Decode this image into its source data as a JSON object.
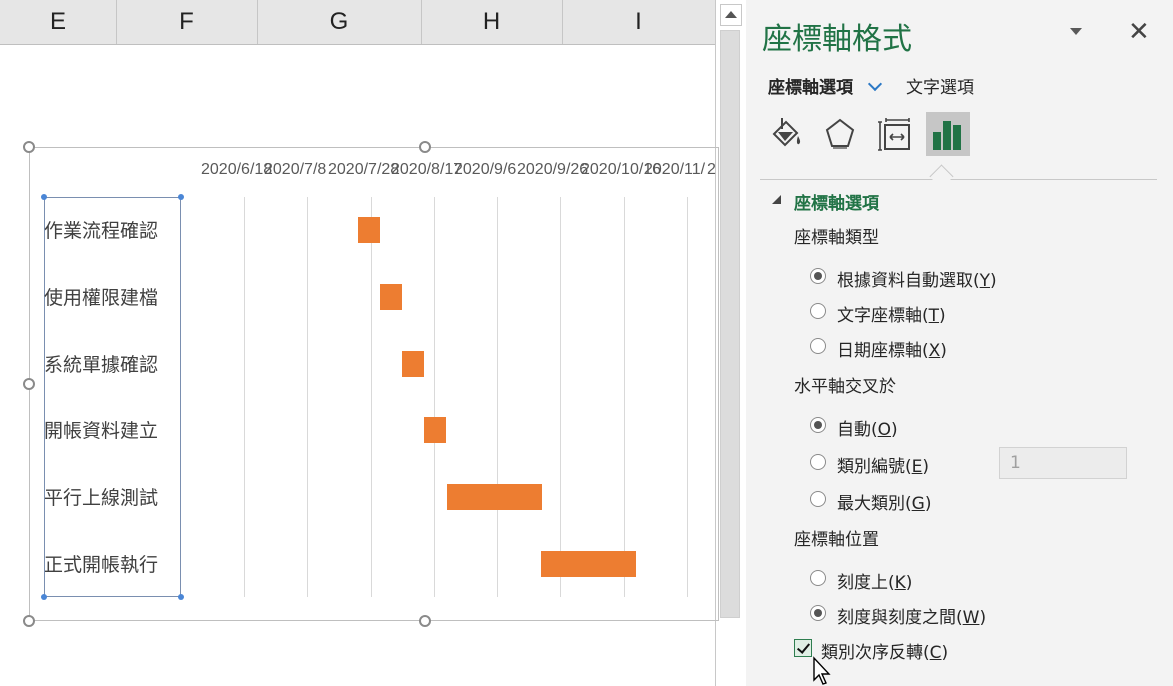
{
  "sheet": {
    "columns": [
      "E",
      "F",
      "G",
      "H",
      "I"
    ]
  },
  "chart": {
    "x_tick_labels": [
      "2020/6/18",
      "2020/7/8",
      "2020/7/28",
      "2020/8/17",
      "2020/9/6",
      "2020/9/26",
      "2020/10/16",
      "2020/11/",
      "2"
    ],
    "categories": [
      "作業流程確認",
      "使用權限建檔",
      "系統單據確認",
      "開帳資料建立",
      "平行上線測試",
      "正式開帳執行"
    ],
    "bar_color": "#ed7d31"
  },
  "chart_data": {
    "type": "bar",
    "orientation": "horizontal",
    "stacked": true,
    "categories": [
      "作業流程確認",
      "使用權限建檔",
      "系統單據確認",
      "開帳資料建立",
      "平行上線測試",
      "正式開帳執行"
    ],
    "x_tick_labels": [
      "2020/6/18",
      "2020/7/8",
      "2020/7/28",
      "2020/8/17",
      "2020/9/6",
      "2020/9/26",
      "2020/10/16",
      "2020/11/"
    ],
    "series": [
      {
        "values": [
          "2020/7/24",
          "2020/7/31",
          "2020/8/7",
          "2020/8/14",
          "2020/8/21",
          "2020/9/20"
        ]
      },
      {
        "values": [
          7,
          7,
          7,
          7,
          30,
          30
        ],
        "color": "#ed7d31"
      }
    ],
    "xlim": [
      "2020/5/29",
      "2020/11/25"
    ],
    "category_order": "reversed",
    "grid": true
  },
  "pane": {
    "title": "座標軸格式",
    "close_label": "✕",
    "tabs": [
      "座標軸選項",
      "文字選項"
    ],
    "icons": [
      "fill-line-icon",
      "effects-icon",
      "size-properties-icon",
      "axis-options-icon"
    ],
    "section_title": "座標軸選項",
    "axis_type": {
      "label": "座標軸類型",
      "options": [
        {
          "text": "根據資料自動選取",
          "key": "Y",
          "checked": true
        },
        {
          "text": "文字座標軸",
          "key": "T",
          "checked": false
        },
        {
          "text": "日期座標軸",
          "key": "X",
          "checked": false
        }
      ]
    },
    "crosses": {
      "label": "水平軸交叉於",
      "options": [
        {
          "text": "自動",
          "key": "O",
          "checked": true
        },
        {
          "text": "類別編號",
          "key": "E",
          "checked": false
        },
        {
          "text": "最大類別",
          "key": "G",
          "checked": false
        }
      ],
      "category_number_value": "1"
    },
    "position": {
      "label": "座標軸位置",
      "options": [
        {
          "text": "刻度上",
          "key": "K",
          "checked": false
        },
        {
          "text": "刻度與刻度之間",
          "key": "W",
          "checked": true
        }
      ]
    },
    "reverse": {
      "text": "類別次序反轉",
      "key": "C",
      "checked": true
    },
    "accent_color": "#217346"
  }
}
